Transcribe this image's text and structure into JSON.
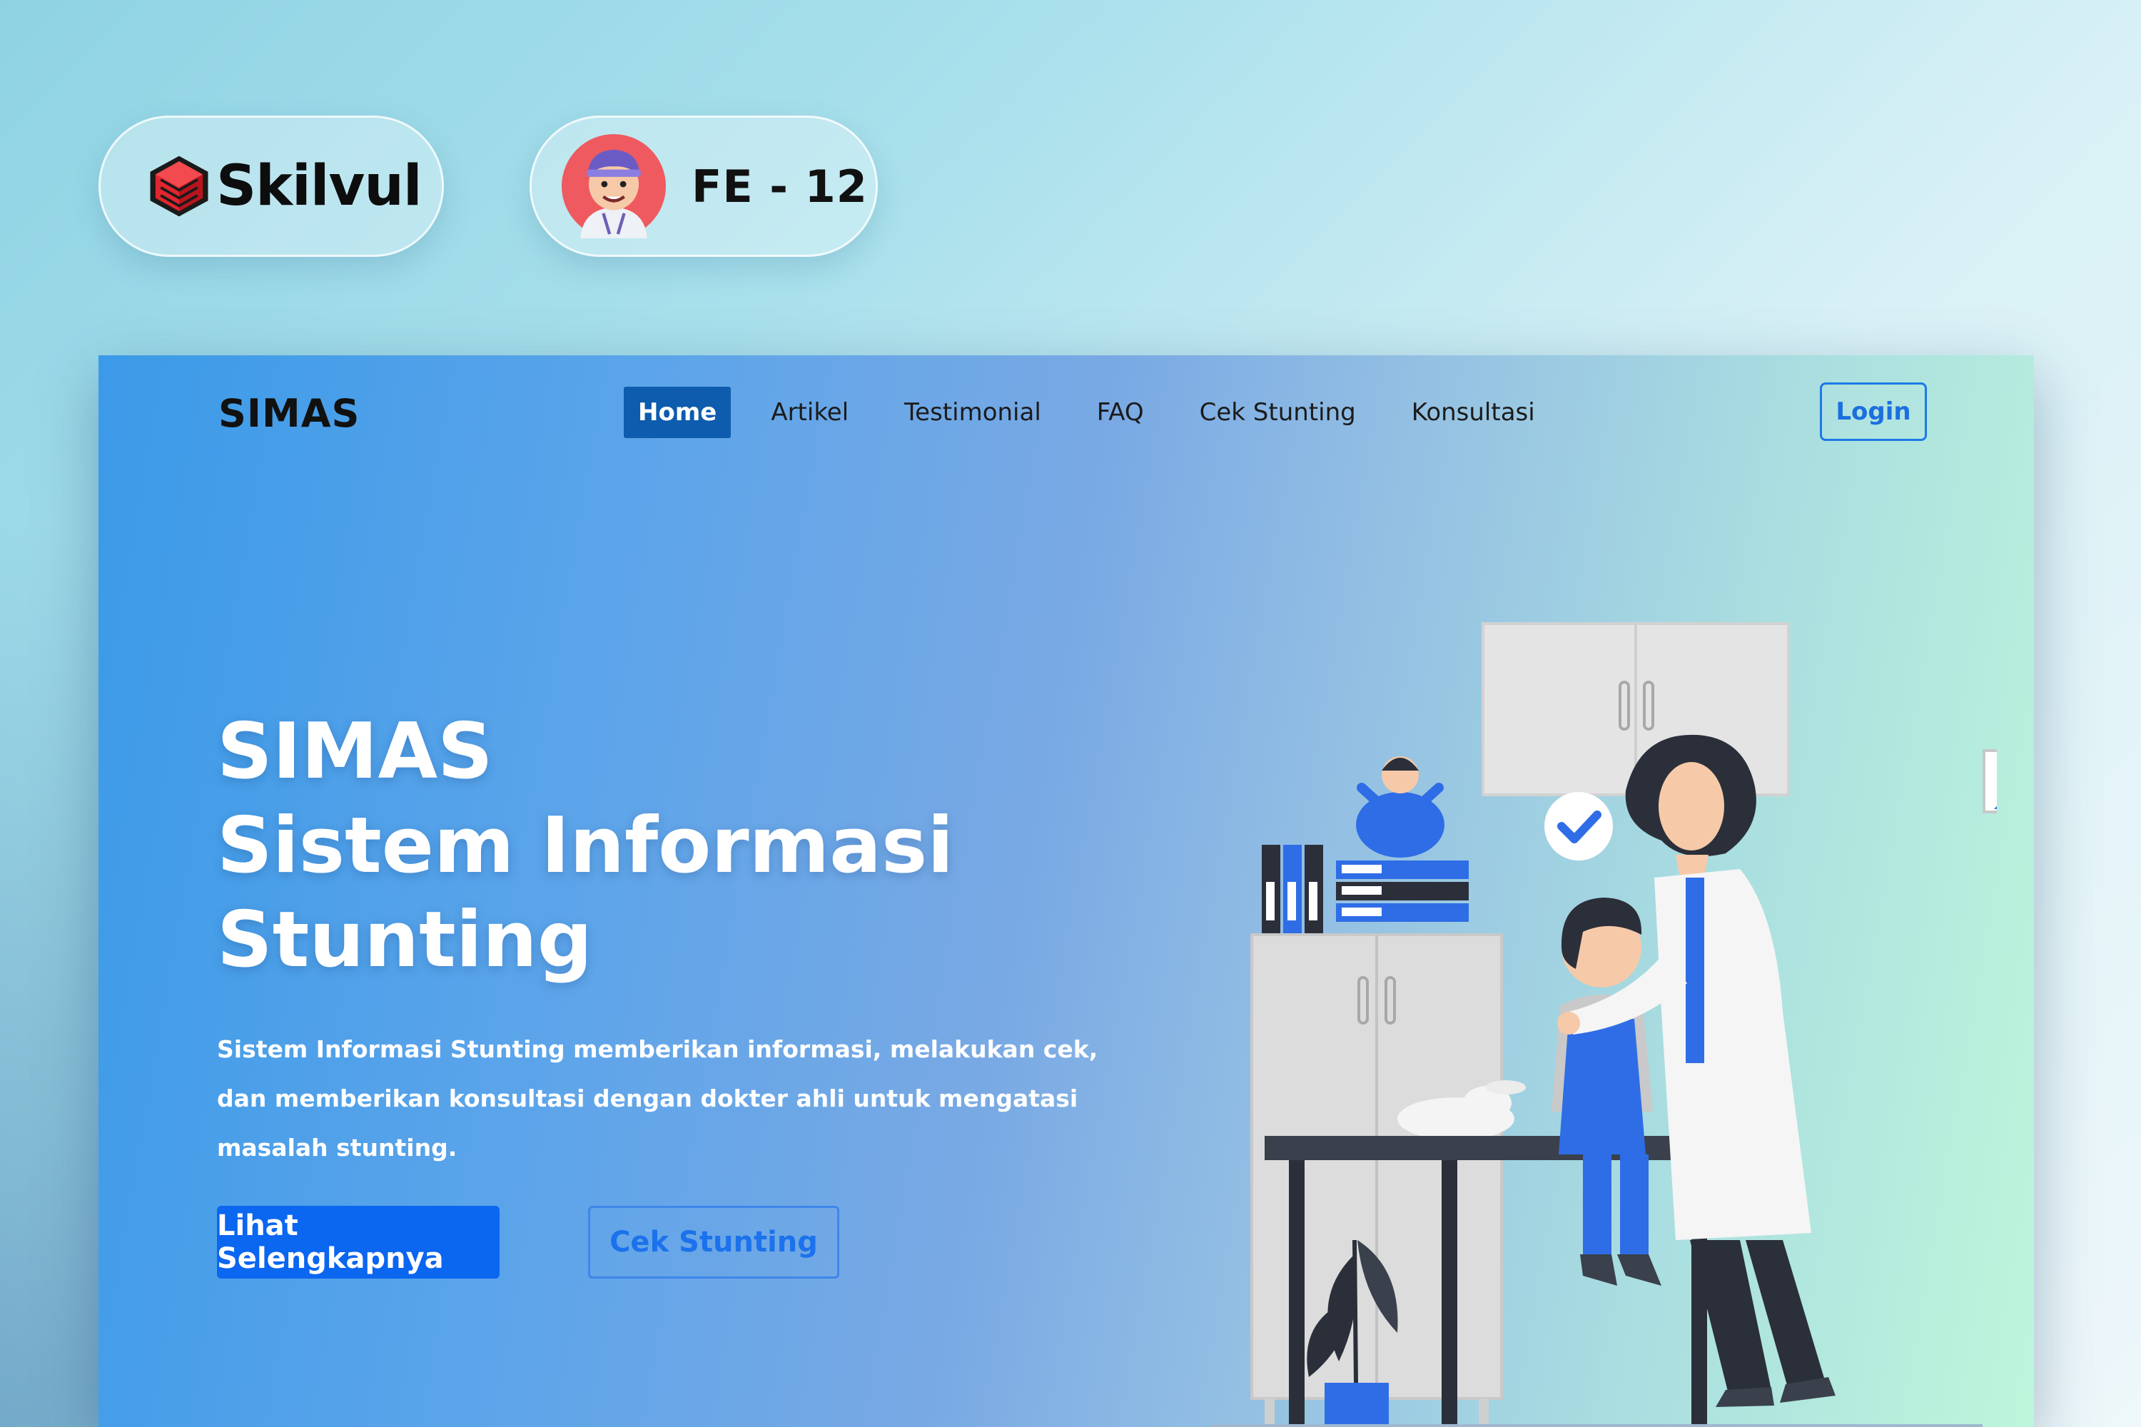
{
  "badges": {
    "brand_name": "Skilvul",
    "team_label": "FE - 12"
  },
  "site": {
    "logo": "SIMAS",
    "nav": [
      "Home",
      "Artikel",
      "Testimonial",
      "FAQ",
      "Cek Stunting",
      "Konsultasi"
    ],
    "active_nav": "Home",
    "login_label": "Login"
  },
  "hero": {
    "title_line1": "SIMAS",
    "title_line2": "Sistem Informasi",
    "title_line3": "Stunting",
    "description_line1": "Sistem Informasi Stunting memberikan informasi, melakukan cek,",
    "description_line2": "dan memberikan konsultasi dengan dokter ahli untuk mengatasi",
    "description_line3": "masalah stunting.",
    "primary_button": "Lihat Selengkapnya",
    "secondary_button": "Cek Stunting"
  },
  "icons": {
    "brand": "skilvul-cube-logo",
    "avatar": "cartoon-avatar",
    "illustration": "doctor-examining-child",
    "checkmark": "check-circle-icon"
  },
  "colors": {
    "brand_red": "#d9202b",
    "nav_active": "#0d5cad",
    "primary_button": "#0b66f0",
    "accent_blue": "#2f6de6"
  }
}
